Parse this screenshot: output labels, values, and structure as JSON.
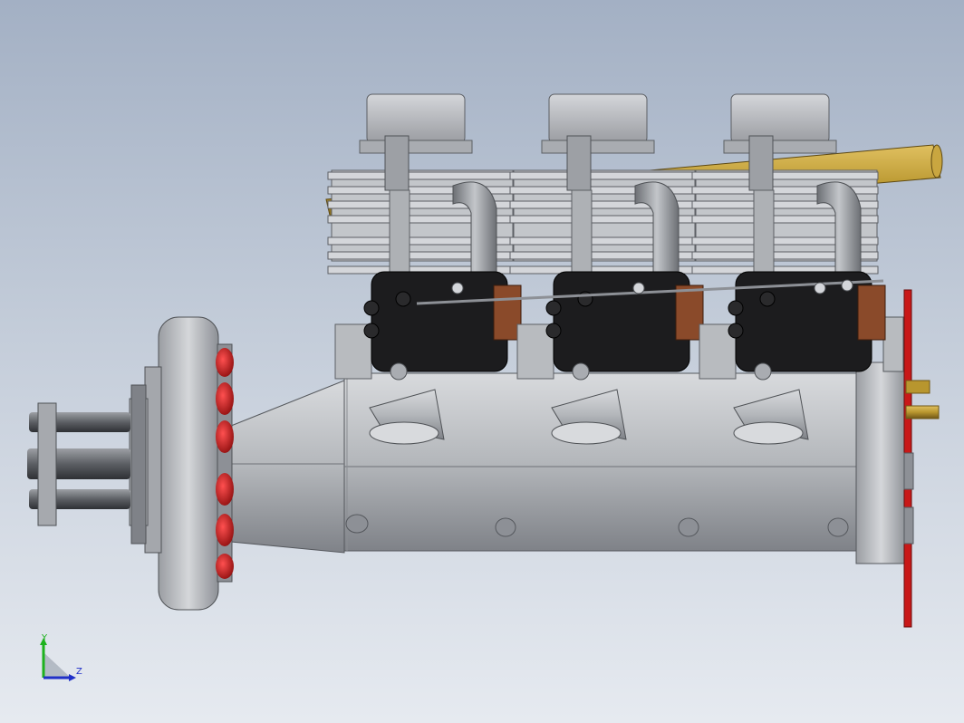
{
  "viewport": {
    "background_top": "#a3b0c4",
    "background_bottom": "#e6eaf0"
  },
  "model": {
    "cylinder_count": 3,
    "colors": {
      "metal": "#b9bbbf",
      "metal_dark": "#7d8086",
      "black": "#1c1c1e",
      "brass": "#b8962e",
      "red": "#c81818",
      "copper": "#8a4a2a"
    }
  },
  "triad": {
    "y_label": "Y",
    "z_label": "Z",
    "y_color": "#1db21d",
    "z_color": "#2030c8"
  }
}
